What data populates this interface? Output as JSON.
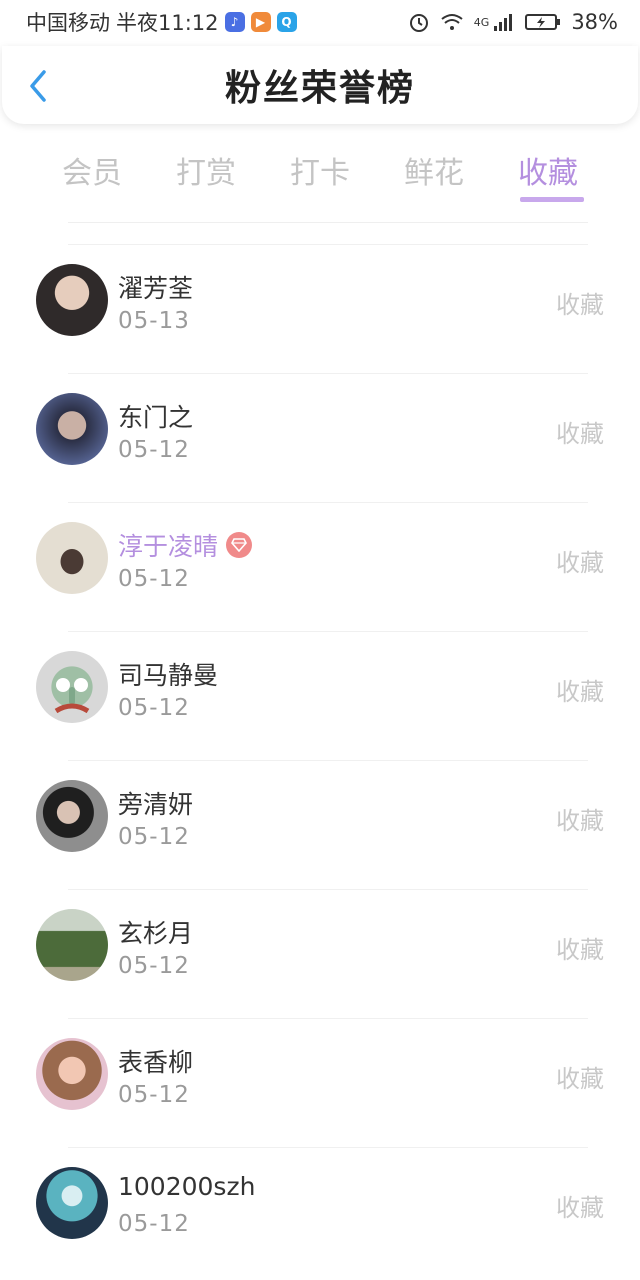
{
  "status_bar": {
    "carrier": "中国移动",
    "time": "半夜11:12",
    "network": "4G",
    "battery": "38%"
  },
  "header": {
    "title": "粉丝荣誉榜"
  },
  "tabs": [
    {
      "label": "会员",
      "active": false
    },
    {
      "label": "打赏",
      "active": false
    },
    {
      "label": "打卡",
      "active": false
    },
    {
      "label": "鲜花",
      "active": false
    },
    {
      "label": "收藏",
      "active": true
    }
  ],
  "fans": [
    {
      "name": "濯芳荃",
      "date": "05-13",
      "action": "收藏",
      "vip": false,
      "avatar_color": "#2f2a2a"
    },
    {
      "name": "东门之",
      "date": "05-12",
      "action": "收藏",
      "vip": false,
      "avatar_color": "#3e4b74"
    },
    {
      "name": "淳于凌晴",
      "date": "05-12",
      "action": "收藏",
      "vip": true,
      "avatar_color": "#d9d3c6"
    },
    {
      "name": "司马静曼",
      "date": "05-12",
      "action": "收藏",
      "vip": false,
      "avatar_color": "#b8c8b3"
    },
    {
      "name": "旁清妍",
      "date": "05-12",
      "action": "收藏",
      "vip": false,
      "avatar_color": "#6b6b6b"
    },
    {
      "name": "玄杉月",
      "date": "05-12",
      "action": "收藏",
      "vip": false,
      "avatar_color": "#5f7b4a"
    },
    {
      "name": "表香柳",
      "date": "05-12",
      "action": "收藏",
      "vip": false,
      "avatar_color": "#c8a080"
    },
    {
      "name": "100200szh",
      "date": "05-12",
      "action": "收藏",
      "vip": false,
      "avatar_color": "#5e8da0"
    }
  ],
  "colors": {
    "accent": "#b48fdf",
    "back_arrow": "#3a9be8",
    "muted_text": "#c8c8c8"
  }
}
